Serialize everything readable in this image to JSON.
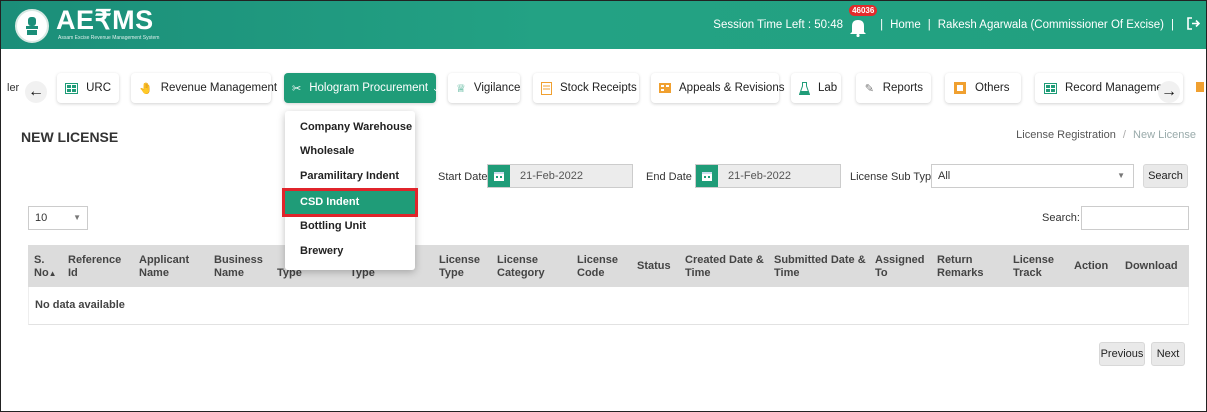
{
  "header": {
    "logo": "AE₹MS",
    "logo_sub": "Assam Excise Revenue Management System",
    "session_label": "Session Time Left : 50:48",
    "notification_count": "46036",
    "home": "Home",
    "separator": "|",
    "user": "Rakesh Agarwala (Commissioner Of Excise)"
  },
  "nav": {
    "left_truncated": "ler",
    "tabs": [
      {
        "label": "URC",
        "icon": "table-icon"
      },
      {
        "label": "Revenue Management",
        "icon": "hand-money-icon"
      },
      {
        "label": "Hologram Procurement",
        "icon": "tags-icon",
        "caret": "⌄"
      },
      {
        "label": "Vigilance",
        "icon": "vigilance-icon"
      },
      {
        "label": "Stock Receipts",
        "icon": "receipt-icon"
      },
      {
        "label": "Appeals & Revisions",
        "icon": "appeal-icon"
      },
      {
        "label": "Lab",
        "icon": "flask-icon"
      },
      {
        "label": "Reports",
        "icon": "report-icon"
      },
      {
        "label": "Others",
        "icon": "box-icon"
      },
      {
        "label": "Record Management",
        "icon": "table-icon"
      }
    ]
  },
  "dropdown": {
    "items": [
      "Company Warehouse",
      "Wholesale",
      "Paramilitary Indent",
      "CSD Indent",
      "Bottling Unit",
      "Brewery"
    ],
    "selected": "CSD Indent"
  },
  "page": {
    "title": "NEW LICENSE",
    "breadcrumb_parent": "License Registration",
    "breadcrumb_sep": "/",
    "breadcrumb_current": "New License"
  },
  "filters": {
    "start_date_label": "Start Date",
    "start_date": "21-Feb-2022",
    "end_date_label": "End Date",
    "end_date": "21-Feb-2022",
    "sub_types_label": "License Sub Types",
    "sub_types_value": "All",
    "search_button": "Search"
  },
  "table": {
    "length_value": "10",
    "search_label": "Search:",
    "columns": [
      [
        "S.",
        "No"
      ],
      [
        "Reference",
        "Id"
      ],
      [
        "Applicant",
        "Name"
      ],
      [
        "Business",
        "Name"
      ],
      [
        "",
        "Type"
      ],
      [
        "",
        "Type"
      ],
      [
        "License",
        "Type"
      ],
      [
        "License",
        "Category"
      ],
      [
        "License",
        "Code"
      ],
      [
        "Status",
        ""
      ],
      [
        "Created Date &",
        "Time"
      ],
      [
        "Submitted Date &",
        "Time"
      ],
      [
        "Assigned",
        "To"
      ],
      [
        "Return",
        "Remarks"
      ],
      [
        "License",
        "Track"
      ],
      [
        "Action",
        ""
      ],
      [
        "Download",
        ""
      ]
    ],
    "empty_text": "No data available"
  },
  "pagination": {
    "previous": "Previous",
    "next": "Next"
  },
  "colors": {
    "brand": "#1f9c78",
    "highlight": "#e0242b",
    "badge": "#e32b2b"
  }
}
